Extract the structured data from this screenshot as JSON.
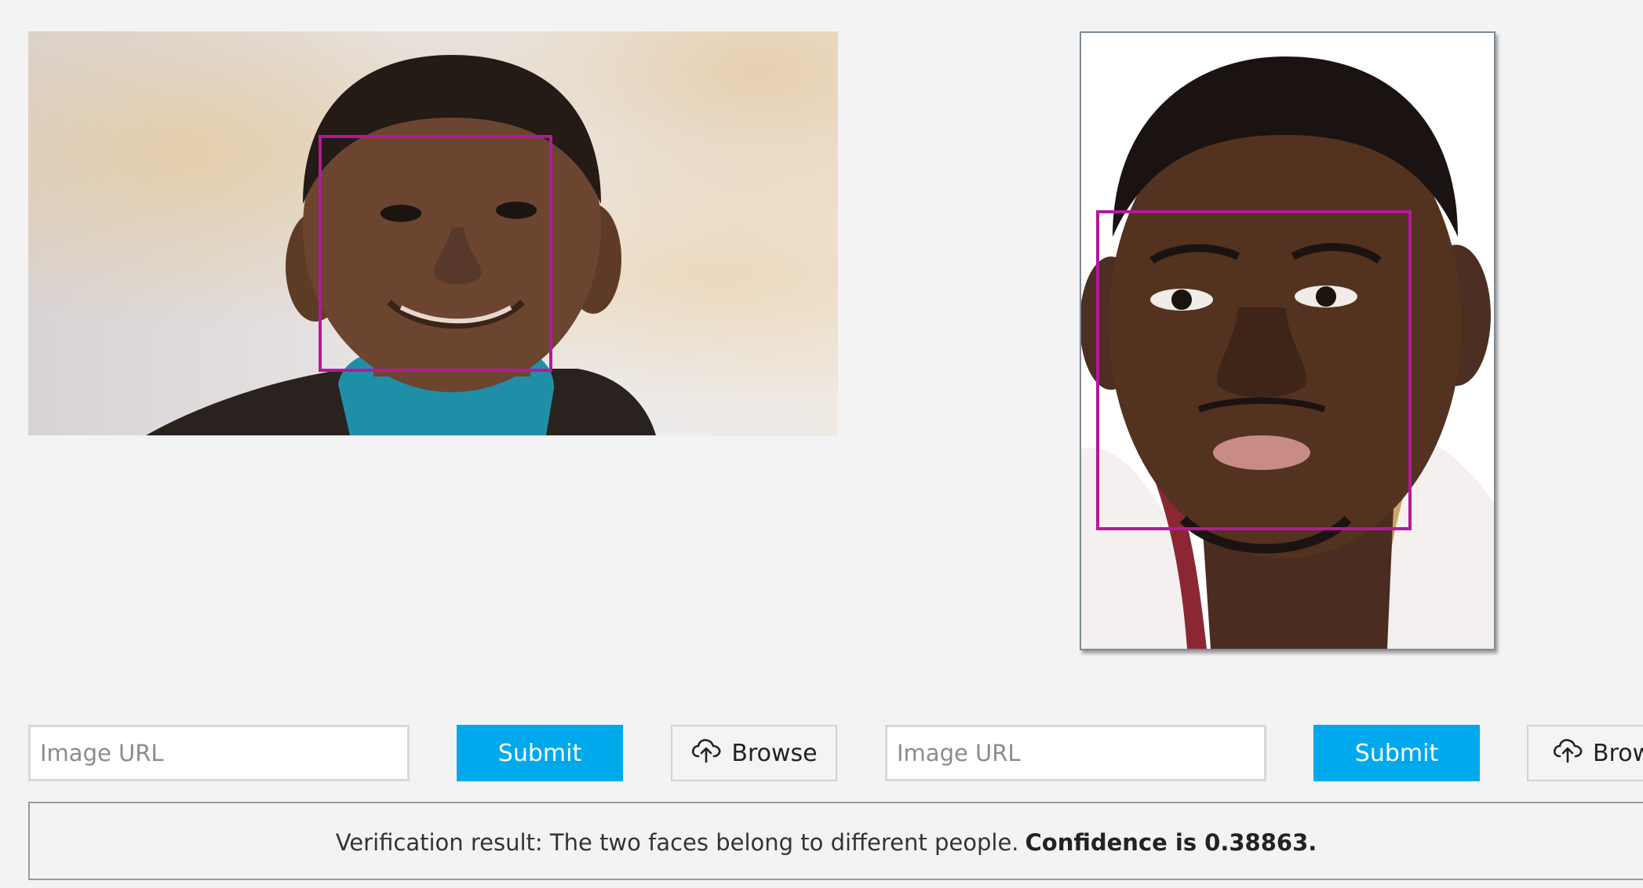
{
  "left_panel": {
    "url_placeholder": "Image URL",
    "submit_label": "Submit",
    "browse_label": "Browse"
  },
  "right_panel": {
    "url_placeholder": "Image URL",
    "submit_label": "Submit",
    "browse_label": "Brow"
  },
  "result": {
    "prefix": "Verification result: The two faces belong to different people.",
    "confidence": "Confidence is 0.38863."
  },
  "colors": {
    "face_box": "#b4199a",
    "submit": "#00a8ec"
  },
  "icons": {
    "browse": "cloud-upload-icon"
  }
}
